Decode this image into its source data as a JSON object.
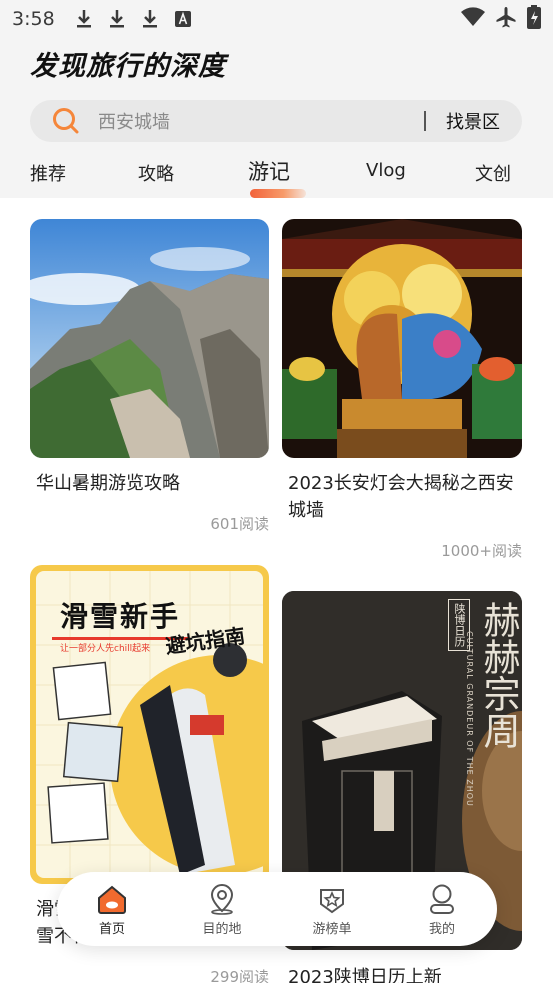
{
  "status_bar": {
    "time": "3:58"
  },
  "header": {
    "logo": "发现旅行的深度"
  },
  "search": {
    "placeholder": "西安城墙",
    "action": "找景区"
  },
  "tabs": [
    {
      "label": "推荐"
    },
    {
      "label": "攻略"
    },
    {
      "label": "游记",
      "active": true
    },
    {
      "label": "Vlog"
    },
    {
      "label": "文创"
    }
  ],
  "feed": {
    "cards": [
      {
        "title": "华山暑期游览攻略",
        "reads": "601阅读"
      },
      {
        "title": "2023长安灯会大揭秘之西安城墙",
        "reads": "1000+阅读"
      },
      {
        "title": "滑雪新手避坑指南，让你滑雪不花冤枉钱指南",
        "reads": "299阅读",
        "poster_title": "滑雪新手",
        "poster_sub": "避坑指南",
        "poster_tag": "让一部分人先chill起来"
      },
      {
        "title": "2023陕博日历上新",
        "poster_title": "赫赫宗周",
        "poster_seal": "陕博日历",
        "poster_en": "CULTURAL GRANDEUR OF THE ZHOU"
      }
    ]
  },
  "bottom_nav": [
    {
      "label": "首页",
      "icon": "home-icon",
      "active": true
    },
    {
      "label": "目的地",
      "icon": "location-pin-icon"
    },
    {
      "label": "游榜单",
      "icon": "ranking-badge-icon"
    },
    {
      "label": "我的",
      "icon": "profile-icon"
    }
  ],
  "colors": {
    "accent": "#f5863a",
    "tab_underline": "#f2623a",
    "background": "#f4f4f4"
  }
}
